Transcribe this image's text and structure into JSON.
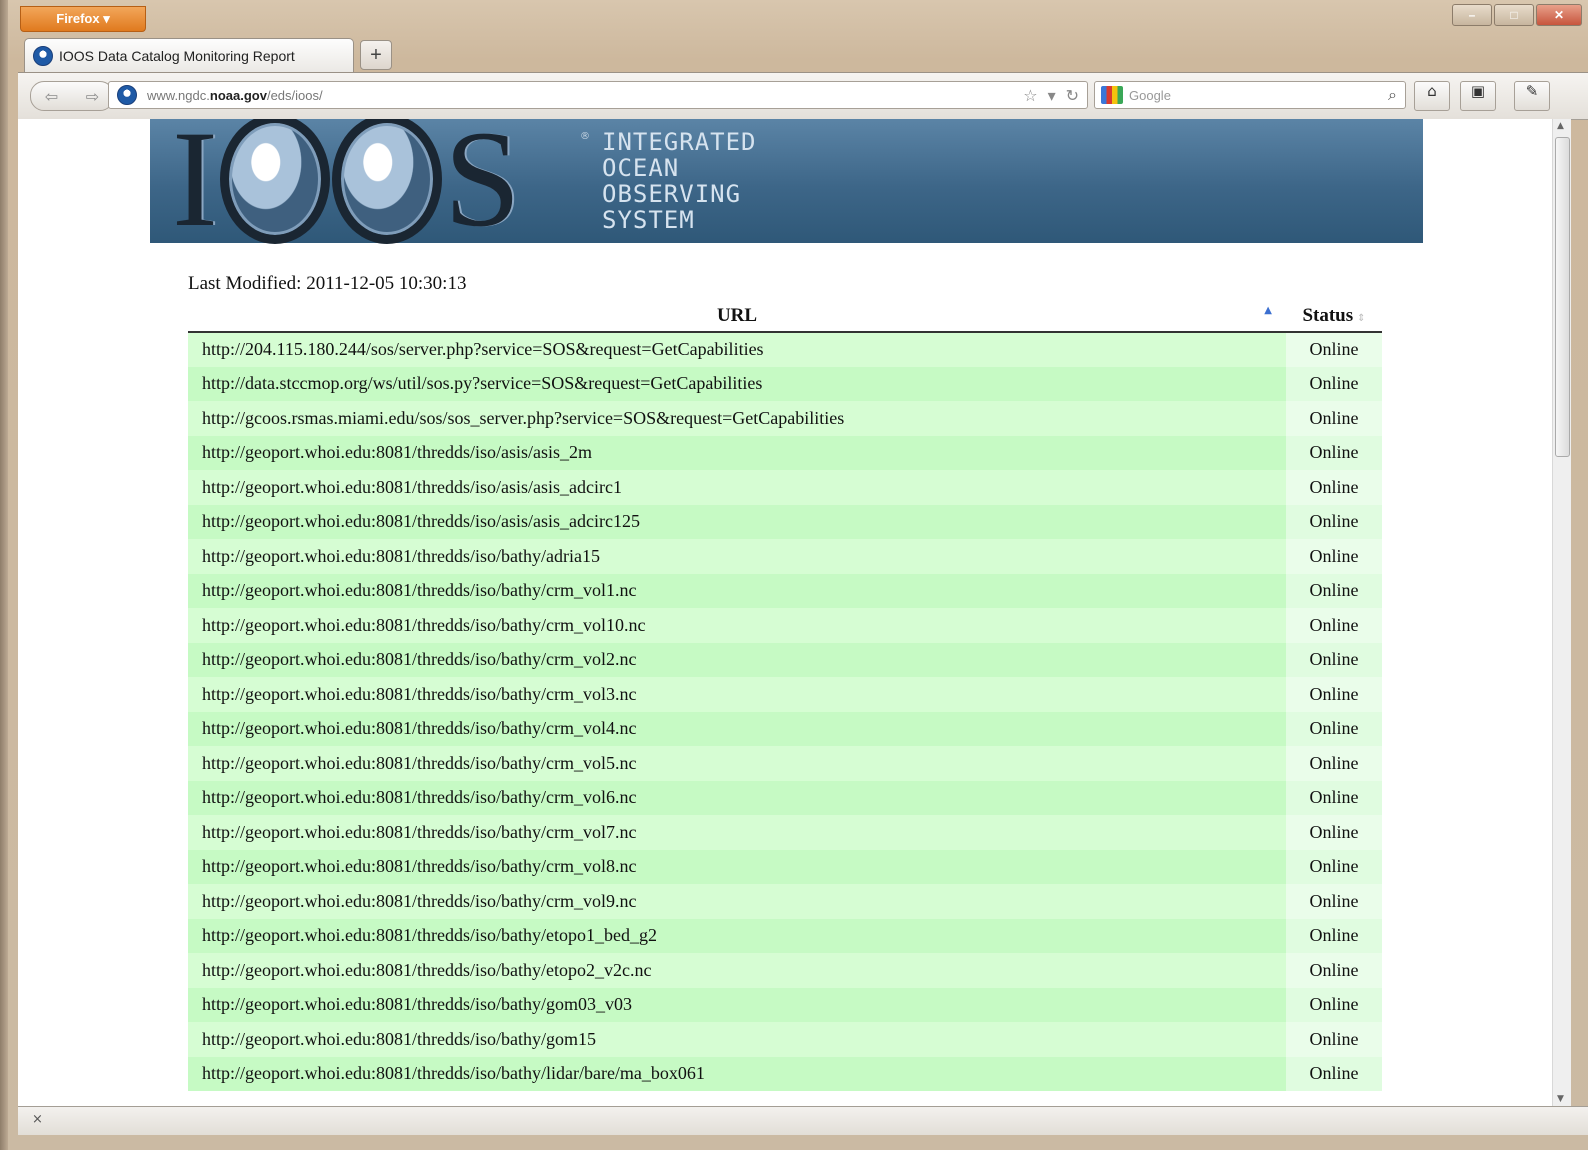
{
  "browser": {
    "app_button": "Firefox",
    "tab_title": "IOOS Data Catalog Monitoring Report",
    "new_tab_label": "+",
    "url_prefix": "www.ngdc.",
    "url_domain": "noaa.gov",
    "url_suffix": "/eds/ioos/",
    "search_placeholder": "Google",
    "status_close": "×"
  },
  "banner": {
    "logo_text_i": "I",
    "logo_text_s": "S",
    "registered": "®",
    "lines": [
      "INTEGRATED",
      "OCEAN",
      "OBSERVING",
      "SYSTEM"
    ]
  },
  "report": {
    "last_modified": "Last Modified: 2011-12-05 10:30:13",
    "col_url": "URL",
    "col_status": "Status",
    "rows": [
      {
        "url": "http://204.115.180.244/sos/server.php?service=SOS&request=GetCapabilities",
        "status": "Online"
      },
      {
        "url": "http://data.stccmop.org/ws/util/sos.py?service=SOS&request=GetCapabilities",
        "status": "Online"
      },
      {
        "url": "http://gcoos.rsmas.miami.edu/sos/sos_server.php?service=SOS&request=GetCapabilities",
        "status": "Online"
      },
      {
        "url": "http://geoport.whoi.edu:8081/thredds/iso/asis/asis_2m",
        "status": "Online"
      },
      {
        "url": "http://geoport.whoi.edu:8081/thredds/iso/asis/asis_adcirc1",
        "status": "Online"
      },
      {
        "url": "http://geoport.whoi.edu:8081/thredds/iso/asis/asis_adcirc125",
        "status": "Online"
      },
      {
        "url": "http://geoport.whoi.edu:8081/thredds/iso/bathy/adria15",
        "status": "Online"
      },
      {
        "url": "http://geoport.whoi.edu:8081/thredds/iso/bathy/crm_vol1.nc",
        "status": "Online"
      },
      {
        "url": "http://geoport.whoi.edu:8081/thredds/iso/bathy/crm_vol10.nc",
        "status": "Online"
      },
      {
        "url": "http://geoport.whoi.edu:8081/thredds/iso/bathy/crm_vol2.nc",
        "status": "Online"
      },
      {
        "url": "http://geoport.whoi.edu:8081/thredds/iso/bathy/crm_vol3.nc",
        "status": "Online"
      },
      {
        "url": "http://geoport.whoi.edu:8081/thredds/iso/bathy/crm_vol4.nc",
        "status": "Online"
      },
      {
        "url": "http://geoport.whoi.edu:8081/thredds/iso/bathy/crm_vol5.nc",
        "status": "Online"
      },
      {
        "url": "http://geoport.whoi.edu:8081/thredds/iso/bathy/crm_vol6.nc",
        "status": "Online"
      },
      {
        "url": "http://geoport.whoi.edu:8081/thredds/iso/bathy/crm_vol7.nc",
        "status": "Online"
      },
      {
        "url": "http://geoport.whoi.edu:8081/thredds/iso/bathy/crm_vol8.nc",
        "status": "Online"
      },
      {
        "url": "http://geoport.whoi.edu:8081/thredds/iso/bathy/crm_vol9.nc",
        "status": "Online"
      },
      {
        "url": "http://geoport.whoi.edu:8081/thredds/iso/bathy/etopo1_bed_g2",
        "status": "Online"
      },
      {
        "url": "http://geoport.whoi.edu:8081/thredds/iso/bathy/etopo2_v2c.nc",
        "status": "Online"
      },
      {
        "url": "http://geoport.whoi.edu:8081/thredds/iso/bathy/gom03_v03",
        "status": "Online"
      },
      {
        "url": "http://geoport.whoi.edu:8081/thredds/iso/bathy/gom15",
        "status": "Online"
      },
      {
        "url": "http://geoport.whoi.edu:8081/thredds/iso/bathy/lidar/bare/ma_box061",
        "status": "Online"
      }
    ]
  }
}
